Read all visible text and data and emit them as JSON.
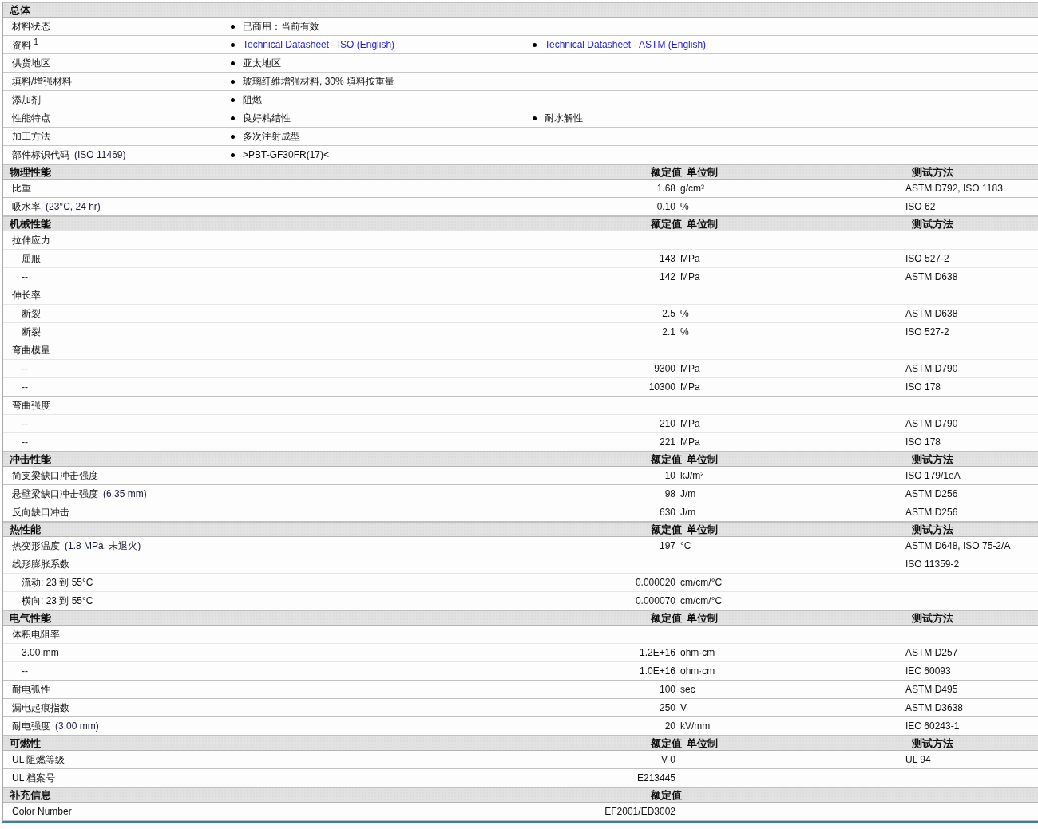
{
  "general": {
    "title": "总体",
    "rows": [
      {
        "label": "材料状态",
        "items": [
          {
            "text": "已商用：当前有效",
            "kind": "text"
          }
        ]
      },
      {
        "label": "资料 $^{1}$",
        "items": [
          {
            "text": "Technical Datasheet - ISO (English)",
            "kind": "link"
          },
          {
            "text": "Technical Datasheet - ASTM (English)",
            "kind": "link"
          }
        ]
      },
      {
        "label": "供货地区",
        "items": [
          {
            "text": "亚太地区",
            "kind": "text"
          }
        ]
      },
      {
        "label": "填料/增强材料",
        "items": [
          {
            "text": "玻璃纤維增强材料, 30% 填料按重量",
            "kind": "text"
          }
        ]
      },
      {
        "label": "添加剂",
        "items": [
          {
            "text": "阻燃",
            "kind": "text"
          }
        ]
      },
      {
        "label": "性能特点",
        "items": [
          {
            "text": "良好粘结性",
            "kind": "text"
          },
          {
            "text": "耐水解性",
            "kind": "text"
          }
        ]
      },
      {
        "label": "加工方法",
        "items": [
          {
            "text": "多次注射成型",
            "kind": "text"
          }
        ]
      },
      {
        "label": "部件标识代码",
        "note": "(ISO 11469)",
        "items": [
          {
            "text": ">PBT-GF30FR(17)<",
            "kind": "text"
          }
        ]
      }
    ]
  },
  "sections": [
    {
      "title": "物理性能",
      "headers": {
        "value": "额定值",
        "unit": "单位制",
        "method": "测试方法"
      },
      "rows": [
        {
          "kind": "plain",
          "label": "比重",
          "value": "1.68",
          "unit": "g/cm³",
          "method": "ASTM D792, ISO 1183"
        },
        {
          "kind": "plain",
          "label": "吸水率",
          "note": "(23°C, 24 hr)",
          "value": "0.10",
          "unit": "%",
          "method": "ISO 62"
        }
      ]
    },
    {
      "title": "机械性能",
      "headers": {
        "value": "额定值",
        "unit": "单位制",
        "method": "测试方法"
      },
      "rows": [
        {
          "kind": "group",
          "label": "拉伸应力"
        },
        {
          "kind": "sub",
          "label": "屈服",
          "value": "143",
          "unit": "MPa",
          "method": "ISO 527-2"
        },
        {
          "kind": "sub",
          "label": "--",
          "value": "142",
          "unit": "MPa",
          "method": "ASTM D638"
        },
        {
          "kind": "group",
          "label": "伸长率"
        },
        {
          "kind": "sub",
          "label": "断裂",
          "value": "2.5",
          "unit": "%",
          "method": "ASTM D638"
        },
        {
          "kind": "sub",
          "label": "断裂",
          "value": "2.1",
          "unit": "%",
          "method": "ISO 527-2"
        },
        {
          "kind": "group",
          "label": "弯曲模量"
        },
        {
          "kind": "sub",
          "label": "--",
          "value": "9300",
          "unit": "MPa",
          "method": "ASTM D790"
        },
        {
          "kind": "sub",
          "label": "--",
          "value": "10300",
          "unit": "MPa",
          "method": "ISO 178"
        },
        {
          "kind": "group",
          "label": "弯曲强度"
        },
        {
          "kind": "sub",
          "label": "--",
          "value": "210",
          "unit": "MPa",
          "method": "ASTM D790"
        },
        {
          "kind": "sub",
          "label": "--",
          "value": "221",
          "unit": "MPa",
          "method": "ISO 178"
        }
      ]
    },
    {
      "title": "冲击性能",
      "headers": {
        "value": "额定值",
        "unit": "单位制",
        "method": "测试方法"
      },
      "rows": [
        {
          "kind": "plain",
          "label": "简支梁缺口冲击强度",
          "value": "10",
          "unit": "kJ/m²",
          "method": "ISO 179/1eA"
        },
        {
          "kind": "plain",
          "label": "悬壁梁缺口冲击强度",
          "note": "(6.35 mm)",
          "value": "98",
          "unit": "J/m",
          "method": "ASTM D256"
        },
        {
          "kind": "plain",
          "label": "反向缺口冲击",
          "value": "630",
          "unit": "J/m",
          "method": "ASTM D256"
        }
      ]
    },
    {
      "title": "热性能",
      "headers": {
        "value": "额定值",
        "unit": "单位制",
        "method": "测试方法"
      },
      "rows": [
        {
          "kind": "plain",
          "label": "热变形温度",
          "note": "(1.8 MPa, 未退火)",
          "value": "197",
          "unit": "°C",
          "method": "ASTM D648, ISO 75-2/A"
        },
        {
          "kind": "group",
          "label": "线形膨胀系数",
          "method": "ISO 11359-2"
        },
        {
          "kind": "sub",
          "label": "流动: 23 到  55°C",
          "value": "0.000020",
          "unit": "cm/cm/°C"
        },
        {
          "kind": "sub",
          "label": "横向: 23 到  55°C",
          "value": "0.000070",
          "unit": "cm/cm/°C"
        }
      ]
    },
    {
      "title": "电气性能",
      "headers": {
        "value": "额定值",
        "unit": "单位制",
        "method": "测试方法"
      },
      "rows": [
        {
          "kind": "group",
          "label": "体积电阻率"
        },
        {
          "kind": "sub",
          "label": "3.00 mm",
          "value": "1.2E+16",
          "unit": "ohm·cm",
          "method": "ASTM D257"
        },
        {
          "kind": "sub",
          "label": "--",
          "value": "1.0E+16",
          "unit": "ohm·cm",
          "method": "IEC 60093"
        },
        {
          "kind": "plain",
          "label": "耐电弧性",
          "value": "100",
          "unit": "sec",
          "method": "ASTM D495"
        },
        {
          "kind": "plain",
          "label": "漏电起痕指数",
          "value": "250",
          "unit": "V",
          "method": "ASTM D3638"
        },
        {
          "kind": "plain",
          "label": "耐电强度",
          "note": "(3.00 mm)",
          "value": "20",
          "unit": "kV/mm",
          "method": "IEC 60243-1"
        }
      ]
    },
    {
      "title": "可燃性",
      "headers": {
        "value": "额定值",
        "unit": "单位制",
        "method": "测试方法"
      },
      "rows": [
        {
          "kind": "plain",
          "label": "UL 阻燃等级",
          "value": "V-0",
          "method": "UL 94"
        },
        {
          "kind": "plain",
          "label": "UL 档案号",
          "value": "E213445"
        }
      ]
    },
    {
      "title": "补充信息",
      "headers": {
        "value": "额定值"
      },
      "rows": [
        {
          "kind": "plain",
          "label": "Color Number",
          "value": "EF2001/ED3002"
        }
      ]
    }
  ]
}
